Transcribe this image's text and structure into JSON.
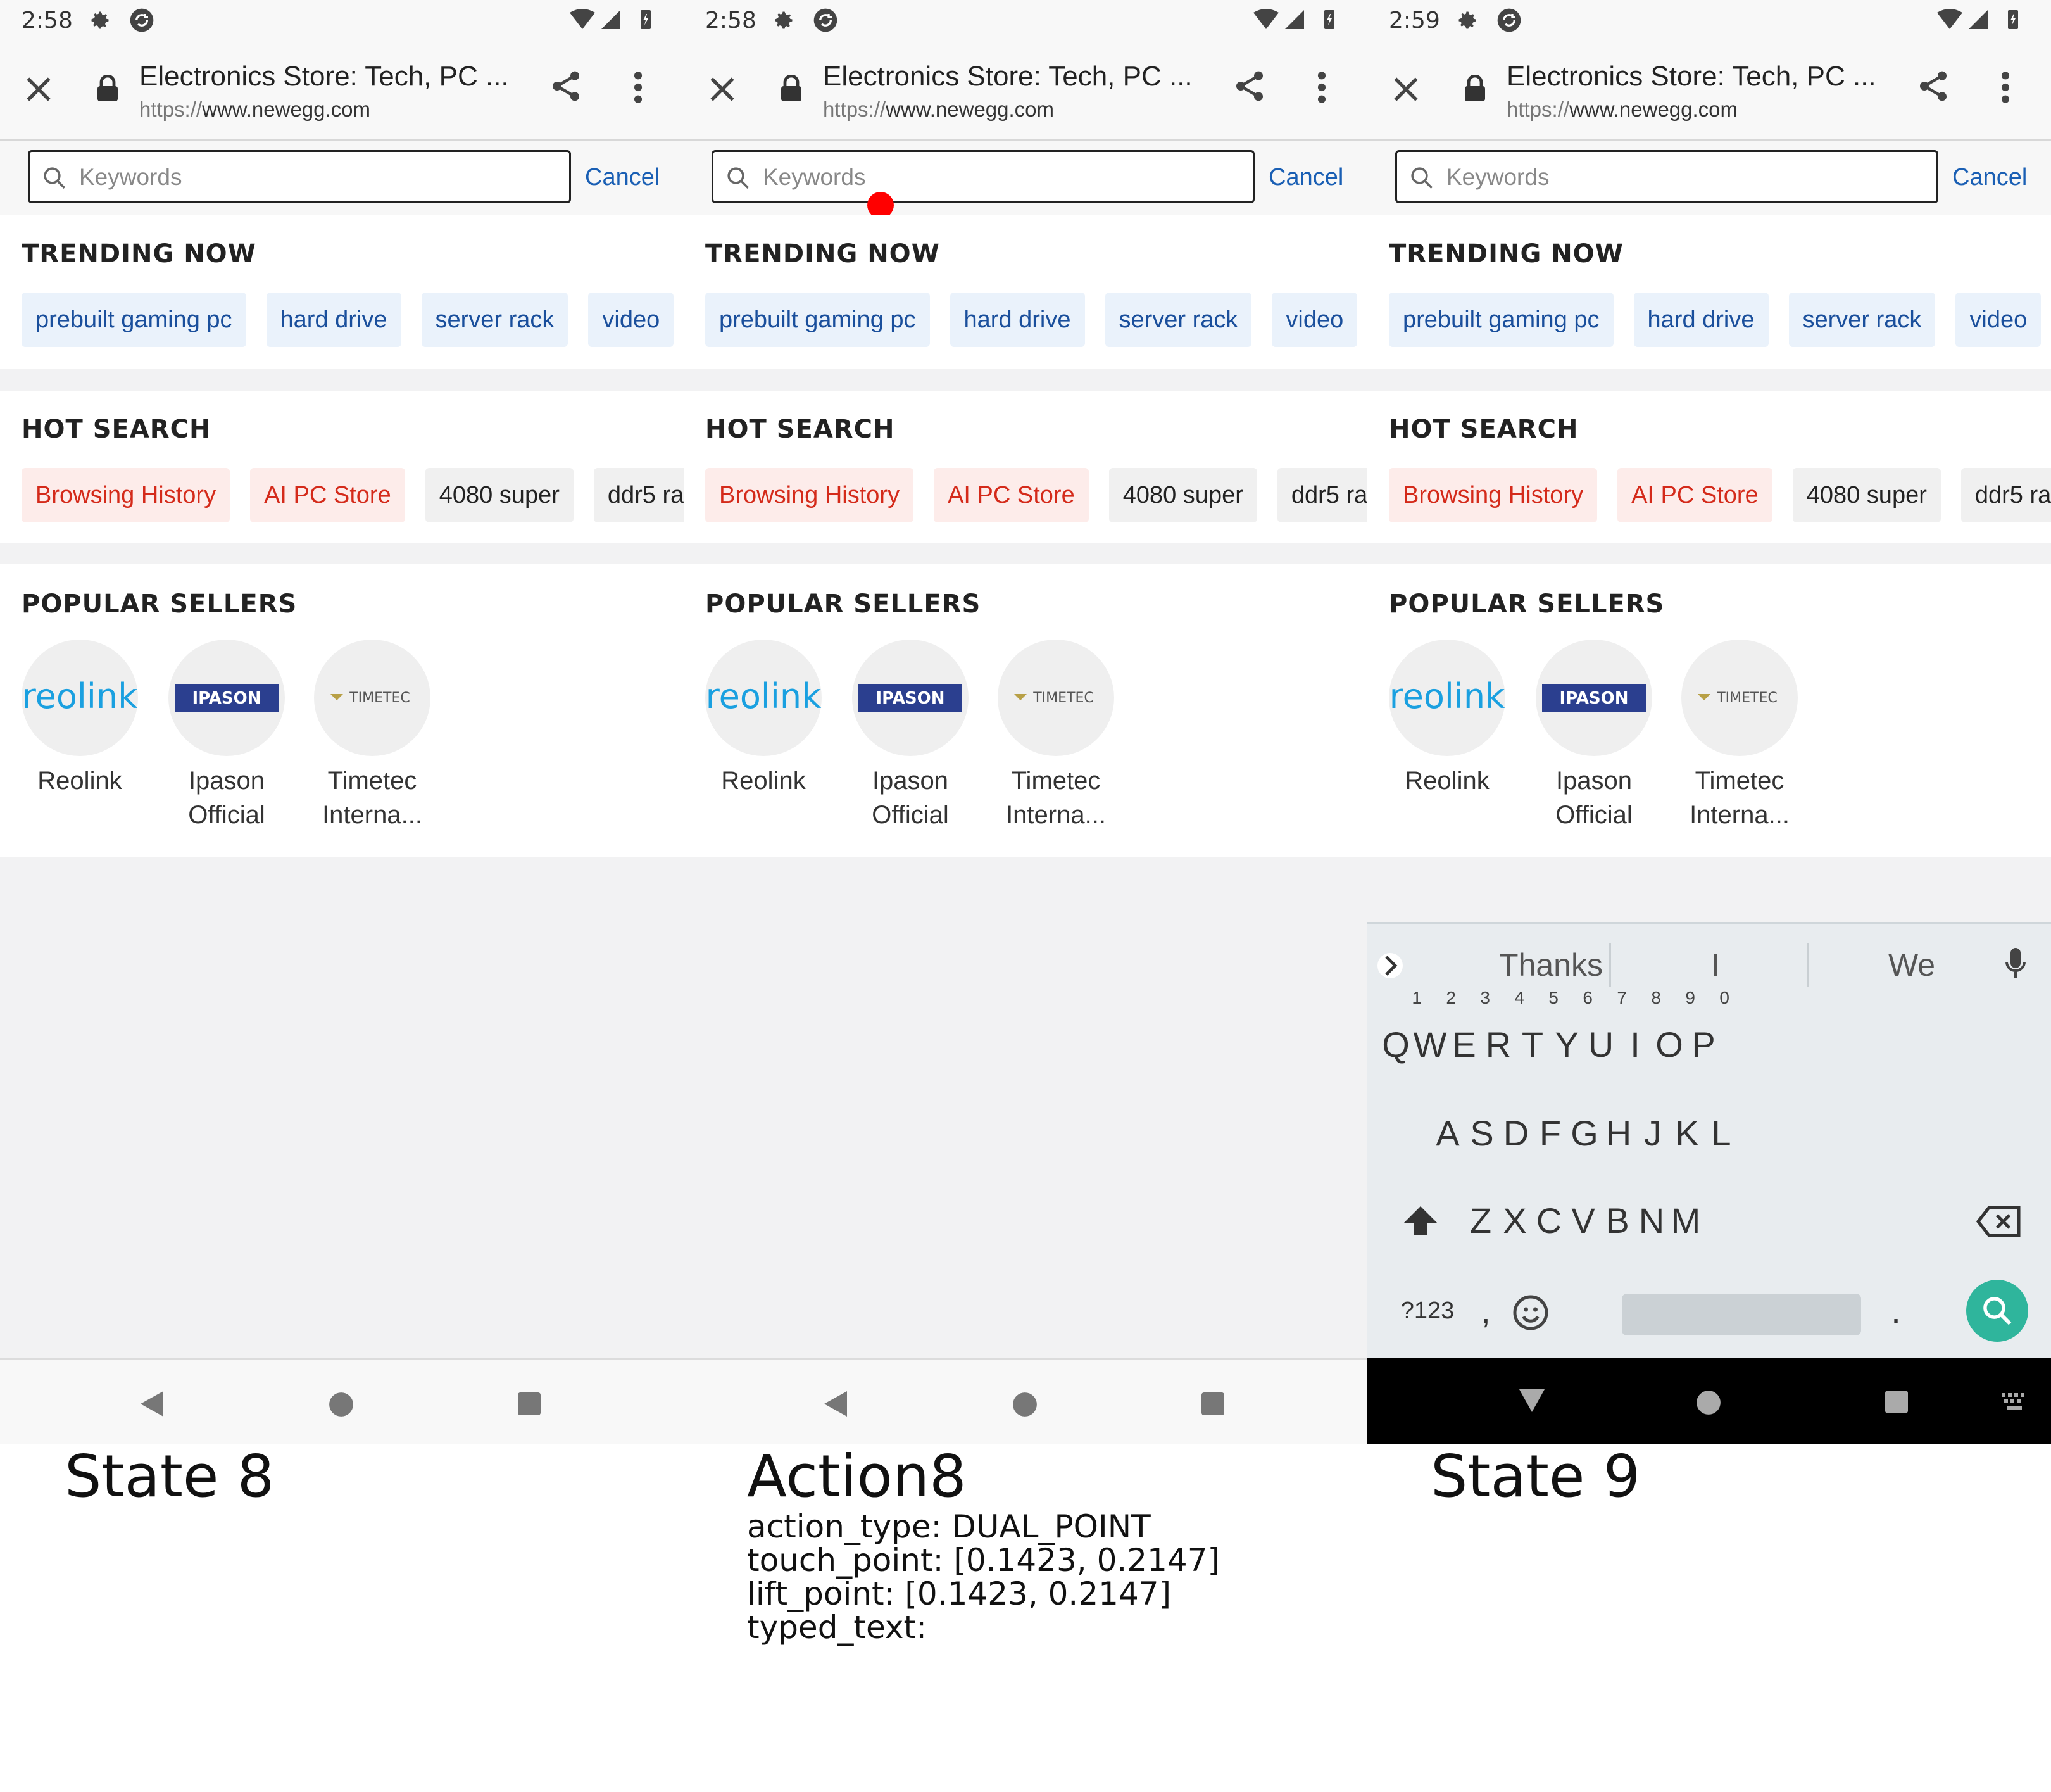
{
  "panels": [
    {
      "status": {
        "time": "2:58"
      },
      "browser": {
        "title": "Electronics Store: Tech, PC ...",
        "url_scheme": "https://",
        "url_host": "www.newegg.com"
      },
      "search": {
        "placeholder": "Keywords",
        "cancel": "Cancel"
      },
      "caption": "State 8"
    },
    {
      "status": {
        "time": "2:58"
      },
      "browser": {
        "title": "Electronics Store: Tech, PC ...",
        "url_scheme": "https://",
        "url_host": "www.newegg.com"
      },
      "search": {
        "placeholder": "Keywords",
        "cancel": "Cancel"
      },
      "caption": "Action8"
    },
    {
      "status": {
        "time": "2:59"
      },
      "browser": {
        "title": "Electronics Store: Tech, PC ...",
        "url_scheme": "https://",
        "url_host": "www.newegg.com"
      },
      "search": {
        "placeholder": "Keywords",
        "cancel": "Cancel"
      },
      "caption": "State 9"
    }
  ],
  "trending": {
    "title": "TRENDING NOW",
    "chips": [
      "prebuilt gaming pc",
      "hard drive",
      "server rack",
      "video"
    ]
  },
  "hot": {
    "title": "HOT SEARCH",
    "chips": [
      "Browsing History",
      "AI PC Store",
      "4080 super",
      "ddr5 ra"
    ]
  },
  "sellers": {
    "title": "POPULAR SELLERS",
    "items": [
      {
        "line1": "Reolink",
        "line2": "",
        "logo_text": "reolink"
      },
      {
        "line1": "Ipason",
        "line2": "Official",
        "logo_text": "IPASON"
      },
      {
        "line1": "Timetec",
        "line2": "Interna...",
        "logo_text": "TIMETEC"
      }
    ]
  },
  "action": {
    "line1": "action_type: DUAL_POINT",
    "line2": "touch_point: [0.1423, 0.2147]",
    "line3": "lift_point: [0.1423, 0.2147]",
    "line4": "typed_text:"
  },
  "keyboard": {
    "suggestions": [
      "Thanks",
      "I",
      "We"
    ],
    "row1": [
      "Q",
      "W",
      "E",
      "R",
      "T",
      "Y",
      "U",
      "I",
      "O",
      "P"
    ],
    "row1_hints": [
      "1",
      "2",
      "3",
      "4",
      "5",
      "6",
      "7",
      "8",
      "9",
      "0"
    ],
    "row2": [
      "A",
      "S",
      "D",
      "F",
      "G",
      "H",
      "J",
      "K",
      "L"
    ],
    "row3": [
      "Z",
      "X",
      "C",
      "V",
      "B",
      "N",
      "M"
    ],
    "sym": "?123",
    "comma": ",",
    "period": "."
  },
  "colors": {
    "link_blue": "#1a5fb4",
    "hot_red": "#d42a1a",
    "search_green": "#2fb59c",
    "tap_red": "#ff0000"
  }
}
